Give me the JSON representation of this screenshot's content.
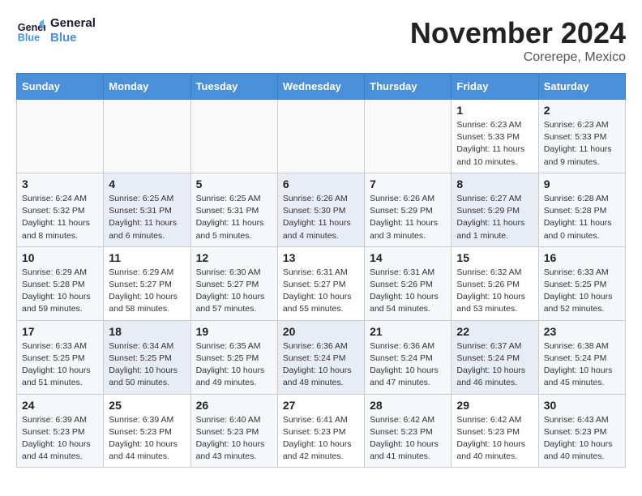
{
  "header": {
    "logo_line1": "General",
    "logo_line2": "Blue",
    "month": "November 2024",
    "location": "Corerepe, Mexico"
  },
  "days_of_week": [
    "Sunday",
    "Monday",
    "Tuesday",
    "Wednesday",
    "Thursday",
    "Friday",
    "Saturday"
  ],
  "weeks": [
    [
      {
        "day": "",
        "info": ""
      },
      {
        "day": "",
        "info": ""
      },
      {
        "day": "",
        "info": ""
      },
      {
        "day": "",
        "info": ""
      },
      {
        "day": "",
        "info": ""
      },
      {
        "day": "1",
        "info": "Sunrise: 6:23 AM\nSunset: 5:33 PM\nDaylight: 11 hours and 10 minutes."
      },
      {
        "day": "2",
        "info": "Sunrise: 6:23 AM\nSunset: 5:33 PM\nDaylight: 11 hours and 9 minutes."
      }
    ],
    [
      {
        "day": "3",
        "info": "Sunrise: 6:24 AM\nSunset: 5:32 PM\nDaylight: 11 hours and 8 minutes."
      },
      {
        "day": "4",
        "info": "Sunrise: 6:25 AM\nSunset: 5:31 PM\nDaylight: 11 hours and 6 minutes."
      },
      {
        "day": "5",
        "info": "Sunrise: 6:25 AM\nSunset: 5:31 PM\nDaylight: 11 hours and 5 minutes."
      },
      {
        "day": "6",
        "info": "Sunrise: 6:26 AM\nSunset: 5:30 PM\nDaylight: 11 hours and 4 minutes."
      },
      {
        "day": "7",
        "info": "Sunrise: 6:26 AM\nSunset: 5:29 PM\nDaylight: 11 hours and 3 minutes."
      },
      {
        "day": "8",
        "info": "Sunrise: 6:27 AM\nSunset: 5:29 PM\nDaylight: 11 hours and 1 minute."
      },
      {
        "day": "9",
        "info": "Sunrise: 6:28 AM\nSunset: 5:28 PM\nDaylight: 11 hours and 0 minutes."
      }
    ],
    [
      {
        "day": "10",
        "info": "Sunrise: 6:29 AM\nSunset: 5:28 PM\nDaylight: 10 hours and 59 minutes."
      },
      {
        "day": "11",
        "info": "Sunrise: 6:29 AM\nSunset: 5:27 PM\nDaylight: 10 hours and 58 minutes."
      },
      {
        "day": "12",
        "info": "Sunrise: 6:30 AM\nSunset: 5:27 PM\nDaylight: 10 hours and 57 minutes."
      },
      {
        "day": "13",
        "info": "Sunrise: 6:31 AM\nSunset: 5:27 PM\nDaylight: 10 hours and 55 minutes."
      },
      {
        "day": "14",
        "info": "Sunrise: 6:31 AM\nSunset: 5:26 PM\nDaylight: 10 hours and 54 minutes."
      },
      {
        "day": "15",
        "info": "Sunrise: 6:32 AM\nSunset: 5:26 PM\nDaylight: 10 hours and 53 minutes."
      },
      {
        "day": "16",
        "info": "Sunrise: 6:33 AM\nSunset: 5:25 PM\nDaylight: 10 hours and 52 minutes."
      }
    ],
    [
      {
        "day": "17",
        "info": "Sunrise: 6:33 AM\nSunset: 5:25 PM\nDaylight: 10 hours and 51 minutes."
      },
      {
        "day": "18",
        "info": "Sunrise: 6:34 AM\nSunset: 5:25 PM\nDaylight: 10 hours and 50 minutes."
      },
      {
        "day": "19",
        "info": "Sunrise: 6:35 AM\nSunset: 5:25 PM\nDaylight: 10 hours and 49 minutes."
      },
      {
        "day": "20",
        "info": "Sunrise: 6:36 AM\nSunset: 5:24 PM\nDaylight: 10 hours and 48 minutes."
      },
      {
        "day": "21",
        "info": "Sunrise: 6:36 AM\nSunset: 5:24 PM\nDaylight: 10 hours and 47 minutes."
      },
      {
        "day": "22",
        "info": "Sunrise: 6:37 AM\nSunset: 5:24 PM\nDaylight: 10 hours and 46 minutes."
      },
      {
        "day": "23",
        "info": "Sunrise: 6:38 AM\nSunset: 5:24 PM\nDaylight: 10 hours and 45 minutes."
      }
    ],
    [
      {
        "day": "24",
        "info": "Sunrise: 6:39 AM\nSunset: 5:23 PM\nDaylight: 10 hours and 44 minutes."
      },
      {
        "day": "25",
        "info": "Sunrise: 6:39 AM\nSunset: 5:23 PM\nDaylight: 10 hours and 44 minutes."
      },
      {
        "day": "26",
        "info": "Sunrise: 6:40 AM\nSunset: 5:23 PM\nDaylight: 10 hours and 43 minutes."
      },
      {
        "day": "27",
        "info": "Sunrise: 6:41 AM\nSunset: 5:23 PM\nDaylight: 10 hours and 42 minutes."
      },
      {
        "day": "28",
        "info": "Sunrise: 6:42 AM\nSunset: 5:23 PM\nDaylight: 10 hours and 41 minutes."
      },
      {
        "day": "29",
        "info": "Sunrise: 6:42 AM\nSunset: 5:23 PM\nDaylight: 10 hours and 40 minutes."
      },
      {
        "day": "30",
        "info": "Sunrise: 6:43 AM\nSunset: 5:23 PM\nDaylight: 10 hours and 40 minutes."
      }
    ]
  ]
}
